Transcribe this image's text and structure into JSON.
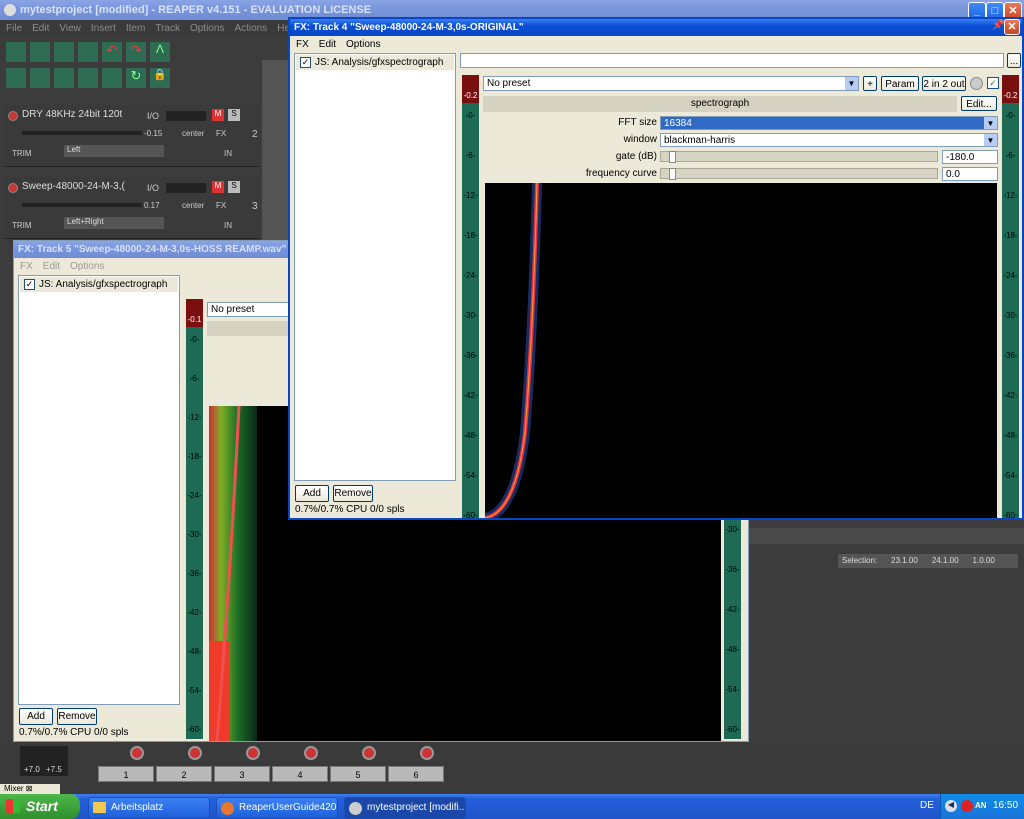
{
  "reaper": {
    "title": "mytestproject [modified] - REAPER v4.151 - EVALUATION LICENSE",
    "menu": [
      "File",
      "Edit",
      "View",
      "Insert",
      "Item",
      "Track",
      "Options",
      "Actions",
      "Help"
    ],
    "tracks": [
      {
        "name": "DRY 48KHz 24bit 120t",
        "io": "I/O",
        "vol": "-0.15",
        "pan": "center",
        "channel": "Left",
        "num": "2"
      },
      {
        "name": "Sweep-48000-24-M-3,(",
        "io": "I/O",
        "vol": "0.17",
        "pan": "center",
        "channel": "Left+Right",
        "num": "3"
      }
    ],
    "trim": "TRIM",
    "mute": "M",
    "solo": "S",
    "fx": "FX",
    "in": "IN",
    "selection": {
      "label": "Selection:",
      "start": "23.1.00",
      "end": "24.1.00",
      "len": "1.0.00"
    },
    "mixer_tab": "Mixer",
    "mixer_nums": [
      "1",
      "2",
      "3",
      "4",
      "5",
      "6"
    ],
    "master": {
      "left": "+7.0",
      "right": "+7.5"
    }
  },
  "fx5": {
    "title": "FX: Track 5 \"Sweep-48000-24-M-3,0s-HOSS REAMP.wav\"",
    "menu": [
      "FX",
      "Edit",
      "Options"
    ],
    "plugin": "JS: Analysis/gfxspectrograph",
    "preset": "No preset",
    "add": "Add",
    "remove": "Remove",
    "cpu": "0.7%/0.7% CPU 0/0 spls",
    "peak": "-0.1",
    "ticks": [
      "-0-",
      "-6-",
      "-12-",
      "-18-",
      "-24-",
      "-30-",
      "-36-",
      "-42-",
      "-48-",
      "-54-",
      "-60-"
    ]
  },
  "fx4": {
    "title": "FX: Track 4 \"Sweep-48000-24-M-3,0s-ORIGINAL\"",
    "menu": [
      "FX",
      "Edit",
      "Options"
    ],
    "plugin": "JS: Analysis/gfxspectrograph",
    "preset": "No preset",
    "plus": "+",
    "param": "Param",
    "io": "2 in 2 out",
    "edit": "Edit...",
    "name": "spectrograph",
    "params": [
      {
        "label": "FFT size",
        "value": "16384"
      },
      {
        "label": "window",
        "value": "blackman-harris"
      },
      {
        "label": "gate (dB)",
        "value": "-180.0"
      },
      {
        "label": "frequency curve",
        "value": "0.0"
      }
    ],
    "add": "Add",
    "remove": "Remove",
    "cpu": "0.7%/0.7% CPU 0/0 spls",
    "peak_left": "-0.2",
    "peak_right": "-0.2",
    "ticks": [
      "-0-",
      "-6-",
      "-12-",
      "-18-",
      "-24-",
      "-30-",
      "-36-",
      "-42-",
      "-48-",
      "-54-",
      "-60-"
    ],
    "right_ticks": [
      "-30-",
      "-36-",
      "-42-",
      "-48-",
      "-54-",
      "-60-"
    ]
  },
  "taskbar": {
    "start": "Start",
    "items": [
      "Arbeitsplatz",
      "ReaperUserGuide420...",
      "mytestproject [modifi..."
    ],
    "lang": "DE",
    "time": "16:50"
  },
  "colors": {
    "xp_blue": "#0a4fd6",
    "meter_green": "#1e6a55",
    "spectro_red": "#e8323c",
    "spectro_green": "#3fae2c"
  }
}
